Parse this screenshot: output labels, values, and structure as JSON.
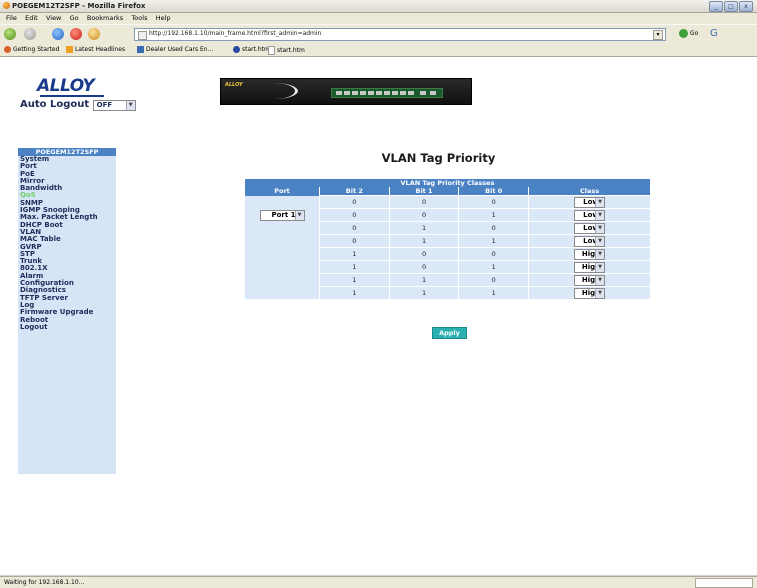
{
  "window": {
    "title": "POEGEM12T2SFP - Mozilla Firefox",
    "buttons": [
      "_",
      "□",
      "x"
    ]
  },
  "menu": [
    "File",
    "Edit",
    "View",
    "Go",
    "Bookmarks",
    "Tools",
    "Help"
  ],
  "nav": {
    "url": "http://192.168.1.10/main_frame.html?first_admin=admin",
    "go_label": "Go"
  },
  "bookmarks": [
    "Getting Started",
    "Latest Headlines",
    "Dealer Used Cars En...",
    "start.htm",
    "start.htm"
  ],
  "status": {
    "text": "Waiting for 192.168.1.10..."
  },
  "logo": {
    "text": "ALLOY"
  },
  "auto_logout": {
    "label": "Auto Logout",
    "value": "OFF"
  },
  "device": {
    "brand": "ALLOY"
  },
  "sidebar": {
    "header": "POEGEM12T2SFP",
    "items": [
      "System",
      "Port",
      "PoE",
      "Mirror",
      "Bandwidth",
      "QoS",
      "SNMP",
      "IGMP Snooping",
      "Max. Packet Length",
      "DHCP Boot",
      "VLAN",
      "MAC Table",
      "GVRP",
      "STP",
      "Trunk",
      "802.1X",
      "Alarm",
      "Configuration",
      "Diagnostics",
      "TFTP Server",
      "Log",
      "Firmware Upgrade",
      "Reboot",
      "Logout"
    ],
    "active_index": 5
  },
  "main": {
    "title": "VLAN Tag Priority",
    "table_caption": "VLAN Tag Priority Classes",
    "columns": [
      "Port",
      "Bit 2",
      "Bit 1",
      "Bit 0",
      "Class"
    ],
    "port_select": "Port 1",
    "rows": [
      {
        "bit2": "0",
        "bit1": "0",
        "bit0": "0",
        "class": "Low"
      },
      {
        "bit2": "0",
        "bit1": "0",
        "bit0": "1",
        "class": "Low"
      },
      {
        "bit2": "0",
        "bit1": "1",
        "bit0": "0",
        "class": "Low"
      },
      {
        "bit2": "0",
        "bit1": "1",
        "bit0": "1",
        "class": "Low"
      },
      {
        "bit2": "1",
        "bit1": "0",
        "bit0": "0",
        "class": "High"
      },
      {
        "bit2": "1",
        "bit1": "0",
        "bit0": "1",
        "class": "High"
      },
      {
        "bit2": "1",
        "bit1": "1",
        "bit0": "0",
        "class": "High"
      },
      {
        "bit2": "1",
        "bit1": "1",
        "bit0": "1",
        "class": "High"
      }
    ],
    "apply_label": "Apply"
  }
}
